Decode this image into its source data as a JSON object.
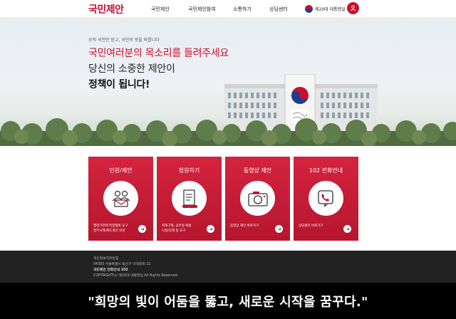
{
  "header": {
    "logo": "국민제안",
    "nav": [
      "국민제안",
      "국민제안참여",
      "소통하기",
      "상담센터"
    ],
    "gov_label": "제20대 대통령실"
  },
  "hero": {
    "subtitle": "오직 국민만 믿고, 국민의 뜻을 따릅니다",
    "line1": "국민여러분의 목소리를 들려주세요",
    "line2": "당신의 소중한 제안이",
    "line3": "정책이 됩니다!"
  },
  "cards": [
    {
      "title": "민원/제안",
      "desc1": "행정기관에 특정행위 요구",
      "desc2": "정부시책/제도개선 의견",
      "icon": "people-document-icon"
    },
    {
      "title": "청원하기",
      "desc1": "피해구제, 공무원 위법",
      "desc2": "시정/징계 등 요구",
      "icon": "scroll-icon"
    },
    {
      "title": "동영상 제안",
      "desc1": "동영상 제안 바로가기",
      "desc2": "",
      "icon": "camera-icon"
    },
    {
      "title": "102 전화안내",
      "desc1": "상담센터 바로가기",
      "desc2": "",
      "icon": "phone-icon"
    }
  ],
  "footer": {
    "links": "개인정보처리방침",
    "address": "04383 서울특별시 용산구 이태원로 22",
    "phone": "국민제안 전화안내 102",
    "copyright": "COPYRIGHT(c) 제20대 대통령실 All Rights Reserved."
  },
  "caption": "\"희망의 빛이 어둠을 뚫고, 새로운 시작을 꿈꾸다.\"",
  "colors": {
    "accent": "#c8102e",
    "footer": "#222222",
    "caption_band": "#000000"
  }
}
